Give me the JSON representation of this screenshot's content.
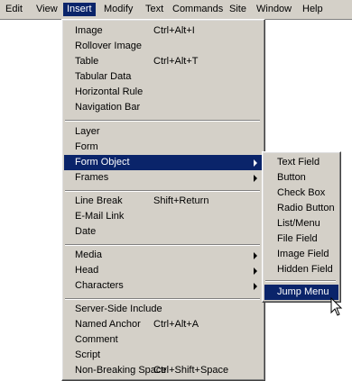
{
  "menubar": {
    "items": [
      {
        "label": "Edit"
      },
      {
        "label": "View"
      },
      {
        "label": "Insert"
      },
      {
        "label": "Modify"
      },
      {
        "label": "Text"
      },
      {
        "label": "Commands"
      },
      {
        "label": "Site"
      },
      {
        "label": "Window"
      },
      {
        "label": "Help"
      }
    ]
  },
  "insert_menu": {
    "items": [
      {
        "label": "Image",
        "shortcut": "Ctrl+Alt+I"
      },
      {
        "label": "Rollover Image",
        "shortcut": ""
      },
      {
        "label": "Table",
        "shortcut": "Ctrl+Alt+T"
      },
      {
        "label": "Tabular Data",
        "shortcut": ""
      },
      {
        "label": "Horizontal Rule",
        "shortcut": ""
      },
      {
        "label": "Navigation Bar",
        "shortcut": ""
      },
      {
        "label": "Layer",
        "shortcut": ""
      },
      {
        "label": "Form",
        "shortcut": ""
      },
      {
        "label": "Form Object",
        "shortcut": ""
      },
      {
        "label": "Frames",
        "shortcut": ""
      },
      {
        "label": "Line Break",
        "shortcut": "Shift+Return"
      },
      {
        "label": "E-Mail Link",
        "shortcut": ""
      },
      {
        "label": "Date",
        "shortcut": ""
      },
      {
        "label": "Media",
        "shortcut": ""
      },
      {
        "label": "Head",
        "shortcut": ""
      },
      {
        "label": "Characters",
        "shortcut": ""
      },
      {
        "label": "Server-Side Include",
        "shortcut": ""
      },
      {
        "label": "Named Anchor",
        "shortcut": "Ctrl+Alt+A"
      },
      {
        "label": "Comment",
        "shortcut": ""
      },
      {
        "label": "Script",
        "shortcut": ""
      },
      {
        "label": "Non-Breaking Space",
        "shortcut": "Ctrl+Shift+Space"
      }
    ]
  },
  "form_object_menu": {
    "items": [
      {
        "label": "Text Field"
      },
      {
        "label": "Button"
      },
      {
        "label": "Check Box"
      },
      {
        "label": "Radio Button"
      },
      {
        "label": "List/Menu"
      },
      {
        "label": "File Field"
      },
      {
        "label": "Image Field"
      },
      {
        "label": "Hidden Field"
      },
      {
        "label": "Jump Menu"
      }
    ]
  },
  "colors": {
    "menu_face": "#d4d0c8",
    "highlight": "#0a246a",
    "highlight_text": "#ffffff"
  }
}
